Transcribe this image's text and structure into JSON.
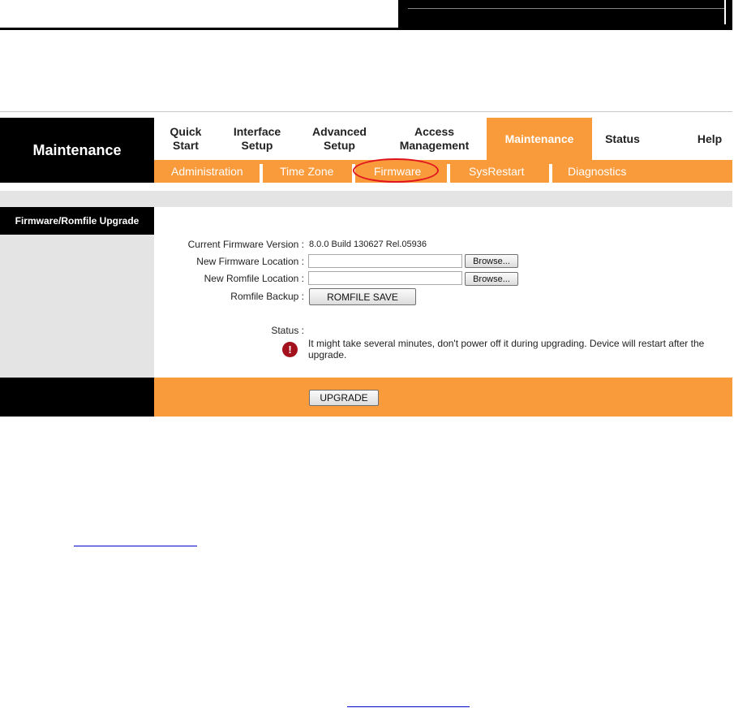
{
  "nav": {
    "title": "Maintenance",
    "tabs": [
      {
        "label": "Quick\nStart"
      },
      {
        "label": "Interface\nSetup"
      },
      {
        "label": "Advanced\nSetup"
      },
      {
        "label": "Access\nManagement"
      },
      {
        "label": "Maintenance"
      },
      {
        "label": "Status"
      },
      {
        "label": "Help"
      }
    ],
    "subtabs": [
      {
        "label": "Administration"
      },
      {
        "label": "Time Zone"
      },
      {
        "label": "Firmware"
      },
      {
        "label": "SysRestart"
      },
      {
        "label": "Diagnostics"
      }
    ]
  },
  "section": {
    "title": "Firmware/Romfile Upgrade"
  },
  "form": {
    "current_version_label": "Current Firmware Version :",
    "current_version_value": "8.0.0 Build 130627 Rel.05936",
    "new_firmware_label": "New Firmware Location :",
    "new_firmware_value": "",
    "new_romfile_label": "New Romfile Location :",
    "new_romfile_value": "",
    "browse_label": "Browse...",
    "romfile_backup_label": "Romfile Backup :",
    "romfile_save_label": "ROMFILE SAVE",
    "status_label": "Status :",
    "status_message": "It might take several minutes, don't power off it during upgrading. Device will restart after the upgrade.",
    "upgrade_label": "UPGRADE"
  },
  "colors": {
    "accent_orange": "#f99a3b",
    "nav_black": "#000000",
    "panel_gray": "#e4e4e4",
    "highlight_red": "#e0141e",
    "warning_red": "#a3121c"
  },
  "icons": {
    "status": "warning-exclamation-icon"
  }
}
